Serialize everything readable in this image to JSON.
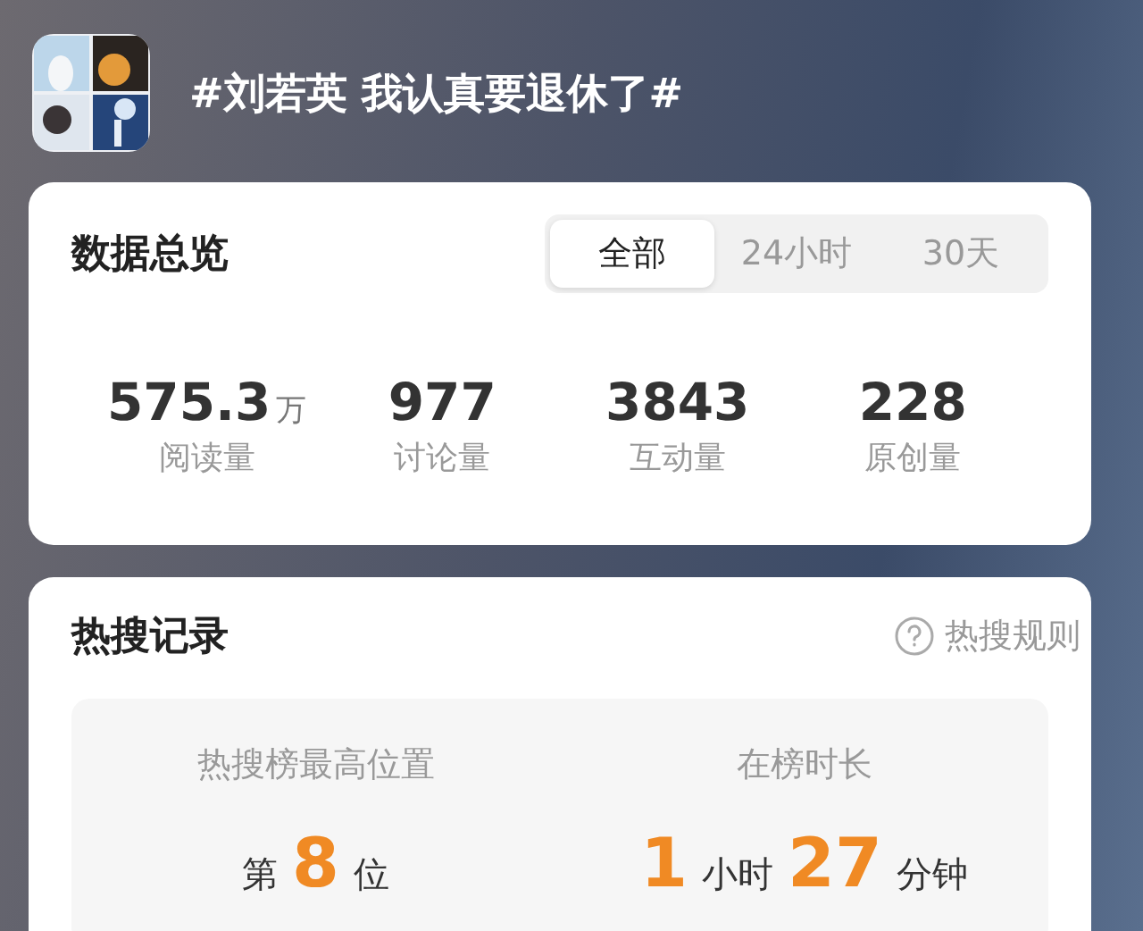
{
  "header": {
    "topic": "#刘若英 我认真要退休了#"
  },
  "overview": {
    "title": "数据总览",
    "tabs": [
      {
        "label": "全部",
        "selected": true
      },
      {
        "label": "24小时",
        "selected": false
      },
      {
        "label": "30天",
        "selected": false
      }
    ],
    "stats": [
      {
        "value": "575.3",
        "unit": "万",
        "label": "阅读量"
      },
      {
        "value": "977",
        "label": "讨论量"
      },
      {
        "value": "3843",
        "label": "互动量"
      },
      {
        "value": "228",
        "label": "原创量"
      }
    ]
  },
  "hot_search": {
    "title": "热搜记录",
    "rules_link": "热搜规则",
    "metrics": [
      {
        "label": "热搜榜最高位置",
        "parts": [
          {
            "kind": "unit",
            "text": "第"
          },
          {
            "kind": "number",
            "text": "8"
          },
          {
            "kind": "unit",
            "text": "位"
          }
        ]
      },
      {
        "label": "在榜时长",
        "parts": [
          {
            "kind": "number",
            "text": "1"
          },
          {
            "kind": "unit",
            "text": "小时"
          },
          {
            "kind": "number",
            "text": "27"
          },
          {
            "kind": "unit",
            "text": "分钟"
          }
        ]
      }
    ]
  }
}
